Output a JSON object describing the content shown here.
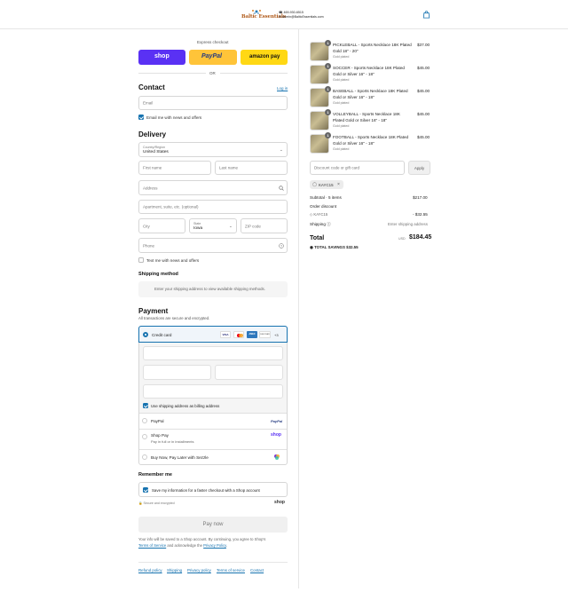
{
  "header": {
    "logo_name": "Baltic Essentials",
    "phone": "469-930-6515",
    "email": "Admin@BalticEssentials.com"
  },
  "express": {
    "title": "Express checkout",
    "shop_label": "shop",
    "paypal_label": "PayPal",
    "amazon_label": "amazon pay",
    "or_label": "OR"
  },
  "contact": {
    "heading": "Contact",
    "login_link": "Log in",
    "email_placeholder": "Email",
    "news_label": "Email me with news and offers"
  },
  "delivery": {
    "heading": "Delivery",
    "country_label": "Country/Region",
    "country_value": "United States",
    "first_name": "First name",
    "last_name": "Last name",
    "address": "Address",
    "apartment": "Apartment, suite, etc. (optional)",
    "city": "City",
    "state_label": "State",
    "state_value": "Iowa",
    "zip": "ZIP code",
    "phone": "Phone",
    "text_news_label": "Text me with news and offers"
  },
  "shipping_method": {
    "heading": "Shipping method",
    "note": "Enter your shipping address to view available shipping methods."
  },
  "payment": {
    "heading": "Payment",
    "secure_note": "All transactions are secure and encrypted.",
    "credit_card_label": "Credit card",
    "cards": [
      "VISA",
      "MC",
      "AMEX",
      "DISCOVER"
    ],
    "more_cards": "+3",
    "billing_same_label": "Use shipping address as billing address",
    "paypal_option": "PayPal",
    "paypal_logo": "PayPal",
    "shoppay_option": "Shop Pay",
    "shoppay_sub": "Pay in full or in installments",
    "shoppay_logo": "shop",
    "sezzle_option": "Buy Now, Pay Later with Sezzle"
  },
  "remember": {
    "heading": "Remember me",
    "save_label": "Save my information for a faster checkout with a Shop account",
    "secure_label": "Secure and encrypted",
    "shop_logo": "shop"
  },
  "pay_button": "Pay now",
  "legal": {
    "text1": "Your info will be saved to a Shop account. By continuing, you agree to Shop's",
    "terms_link": "Terms of Service",
    "text2": "and acknowledge the",
    "privacy_link": "Privacy Policy",
    "end": "."
  },
  "footer_links": [
    "Refund policy",
    "Shipping",
    "Privacy policy",
    "Terms of service",
    "Contact"
  ],
  "cart": {
    "items": [
      {
        "line1": "PICKLEBALL - Sports Necklace 18K Plated",
        "line2": "Gold 18\" - 20\"",
        "variant": "Gold plated",
        "price": "$37.00",
        "qty": "1"
      },
      {
        "line1": "SOCCER - Sports Necklace 18K Plated",
        "line2": "Gold or Silver 16\" - 18\"",
        "variant": "Gold plated",
        "price": "$45.00",
        "qty": "1"
      },
      {
        "line1": "BASEBALL - Sports Necklace 18K Plated",
        "line2": "Gold or Silver 16\" - 18\"",
        "variant": "Gold plated",
        "price": "$45.00",
        "qty": "1"
      },
      {
        "line1": "VOLLEYBALL - Sports Necklace 18K",
        "line2": "Plated Gold or Silver 16\" - 18\"",
        "variant": "Gold plated",
        "price": "$45.00",
        "qty": "1"
      },
      {
        "line1": "FOOTBALL - Sports Necklace 18K Plated",
        "line2": "Gold or Silver 16\" - 18\"",
        "variant": "Gold plated",
        "price": "$45.00",
        "qty": "1"
      }
    ],
    "discount_placeholder": "Discount code or gift card",
    "apply_label": "Apply",
    "applied_code": "KAYC15",
    "subtotal_label": "Subtotal · 5 items",
    "subtotal_value": "$217.00",
    "order_discount_label": "Order discount",
    "discount_code": "KAYC15",
    "discount_value": "- $32.55",
    "shipping_label": "Shipping",
    "shipping_value": "Enter shipping address",
    "total_label": "Total",
    "currency": "USD",
    "total_value": "$184.45",
    "savings_label": "TOTAL SAVINGS",
    "savings_value": "$32.55"
  },
  "colors": {
    "accent": "#1773b0",
    "shop": "#5a31f4",
    "paypal": "#ffc439",
    "amazon": "#ffd814"
  }
}
